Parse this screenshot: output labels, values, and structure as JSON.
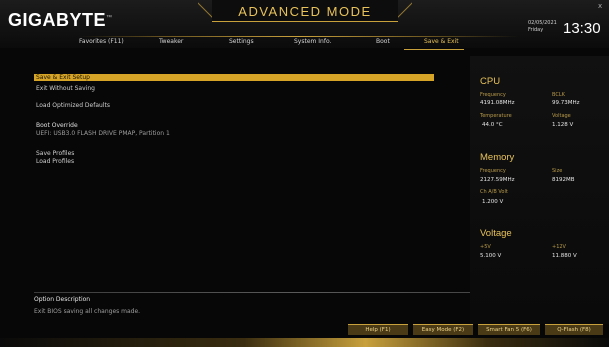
{
  "header": {
    "logo": "GIGABYTE",
    "trademark": "™",
    "mode_title": "ADVANCED MODE",
    "date": "02/05/2021",
    "day": "Friday",
    "time": "13:30",
    "close_glyph": "x"
  },
  "tabs": [
    {
      "label": "Favorites (F11)"
    },
    {
      "label": "Tweaker"
    },
    {
      "label": "Settings"
    },
    {
      "label": "System Info."
    },
    {
      "label": "Boot"
    },
    {
      "label": "Save & Exit",
      "active": true
    }
  ],
  "menu": {
    "save_exit_setup": "Save & Exit Setup",
    "exit_without_saving": "Exit Without Saving",
    "load_optimized_defaults": "Load Optimized Defaults",
    "boot_override": "Boot Override",
    "boot_device": "UEFI: USB3.0 FLASH DRIVE PMAP, Partition 1",
    "save_profiles": "Save Profiles",
    "load_profiles": "Load Profiles"
  },
  "option": {
    "title": "Option Description",
    "description": "Exit BIOS saving all changes made."
  },
  "footer_buttons": [
    {
      "label": "Help (F1)"
    },
    {
      "label": "Easy Mode (F2)"
    },
    {
      "label": "Smart Fan 5 (F6)"
    },
    {
      "label": "Q-Flash (F8)"
    }
  ],
  "panel": {
    "cpu": {
      "title": "CPU",
      "frequency_label": "Frequency",
      "frequency_value": "4191.08MHz",
      "bclk_label": "BCLK",
      "bclk_value": "99.73MHz",
      "temperature_label": "Temperature",
      "temperature_value": "44.0 °C",
      "voltage_label": "Voltage",
      "voltage_value": "1.128 V"
    },
    "memory": {
      "title": "Memory",
      "frequency_label": "Frequency",
      "frequency_value": "2127.59MHz",
      "size_label": "Size",
      "size_value": "8192MB",
      "ch_volt_label": "Ch A/B Volt",
      "ch_volt_value": "1.200 V"
    },
    "voltage": {
      "title": "Voltage",
      "v5_label": "+5V",
      "v5_value": "5.100 V",
      "v12_label": "+12V",
      "v12_value": "11.880 V"
    }
  },
  "colors": {
    "accent": "#d6a528",
    "accent_text": "#e8c25a",
    "background": "#070707"
  }
}
